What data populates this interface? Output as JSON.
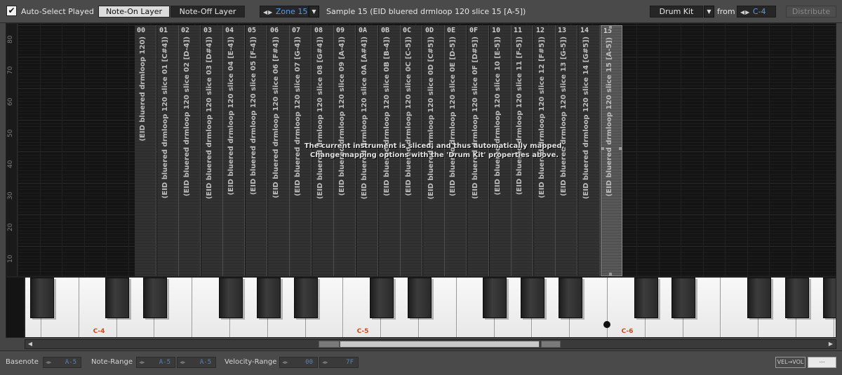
{
  "toolbar": {
    "auto_select_label": "Auto-Select Played",
    "auto_select_checked": "✔",
    "note_on_layer": "Note-On Layer",
    "note_off_layer": "Note-Off Layer",
    "zone_label": "Zone 15",
    "sample_title": "Sample 15 (EID bluered drmloop 120 slice 15 [A-5])",
    "drum_kit_label": "Drum Kit",
    "from_label": "from",
    "from_value": "C-4",
    "distribute_label": "Distribute"
  },
  "grid": {
    "y_ticks": [
      "80",
      "70",
      "60",
      "50",
      "40",
      "30",
      "20",
      "10"
    ],
    "overlay_line1": "The current instrument is sliced, and thus automatically mapped.",
    "overlay_line2": "Change mapping options with the 'Drum Kit' properties above.",
    "zones": [
      {
        "label": "00",
        "name": "(EID bluered drmloop 120)"
      },
      {
        "label": "01",
        "name": "(EID bluered drmloop 120 slice 01 [C#4])"
      },
      {
        "label": "02",
        "name": "(EID bluered drmloop 120 slice 02 [D-4])"
      },
      {
        "label": "03",
        "name": "(EID bluered drmloop 120 slice 03 [D#4])"
      },
      {
        "label": "04",
        "name": "(EID bluered drmloop 120 slice 04 [E-4])"
      },
      {
        "label": "05",
        "name": "(EID bluered drmloop 120 slice 05 [F-4])"
      },
      {
        "label": "06",
        "name": "(EID bluered drmloop 120 slice 06 [F#4])"
      },
      {
        "label": "07",
        "name": "(EID bluered drmloop 120 slice 07 [G-4])"
      },
      {
        "label": "08",
        "name": "(EID bluered drmloop 120 slice 08 [G#4])"
      },
      {
        "label": "09",
        "name": "(EID bluered drmloop 120 slice 09 [A-4])"
      },
      {
        "label": "0A",
        "name": "(EID bluered drmloop 120 slice 0A [A#4])"
      },
      {
        "label": "0B",
        "name": "(EID bluered drmloop 120 slice 0B [B-4])"
      },
      {
        "label": "0C",
        "name": "(EID bluered drmloop 120 slice 0C [C-5])"
      },
      {
        "label": "0D",
        "name": "(EID bluered drmloop 120 slice 0D [C#5])"
      },
      {
        "label": "0E",
        "name": "(EID bluered drmloop 120 slice 0E [D-5])"
      },
      {
        "label": "0F",
        "name": "(EID bluered drmloop 120 slice 0F [D#5])"
      },
      {
        "label": "10",
        "name": "(EID bluered drmloop 120 slice 10 [E-5])"
      },
      {
        "label": "11",
        "name": "(EID bluered drmloop 120 slice 11 [F-5])"
      },
      {
        "label": "12",
        "name": "(EID bluered drmloop 120 slice 12 [F#5])"
      },
      {
        "label": "13",
        "name": "(EID bluered drmloop 120 slice 13 [G-5])"
      },
      {
        "label": "14",
        "name": "(EID bluered drmloop 120 slice 14 [G#5])"
      },
      {
        "label": "15",
        "name": "(EID bluered drmloop 120 slice 15 [A-5])"
      }
    ],
    "selected_zone": "15"
  },
  "keyboard": {
    "octave_labels": [
      "C-4",
      "C-5",
      "C-6"
    ],
    "label_color": "#d24a1a"
  },
  "bottom": {
    "basenote_label": "Basenote",
    "basenote_value": "A-5",
    "note_range_label": "Note-Range",
    "note_range_low": "A-5",
    "note_range_high": "A-5",
    "velocity_range_label": "Velocity-Range",
    "velocity_low": "00",
    "velocity_high": "7F",
    "vel_vol_label": "VEL→VOL",
    "extra_label": "⋯"
  },
  "colors": {
    "accent_blue": "#5a9be0",
    "zone_bg": "#323232",
    "zone_selected_bg": "#585858"
  }
}
